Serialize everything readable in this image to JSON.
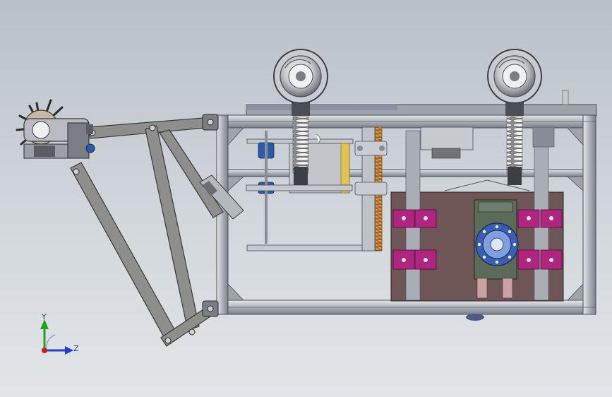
{
  "viewport": {
    "background_top": "#b9c0c8",
    "background_bottom": "#e2e5e8"
  },
  "triad": {
    "y_label": "Y",
    "z_label": "Z",
    "y_color": "#1fa31f",
    "z_color": "#1c3fd0",
    "x_color": "#d01c1c"
  },
  "colors": {
    "frame": "#b8bcc2",
    "frame_edge": "#4a4e55",
    "plate": "#6e5656",
    "magenta_block": "#b0257f",
    "spring": "#d9d9d9",
    "lead_screw": "#c9822f",
    "motor_green": "#5b6b5a",
    "blue_part": "#2a5aa8",
    "link_arm": "#8e8e8c"
  }
}
